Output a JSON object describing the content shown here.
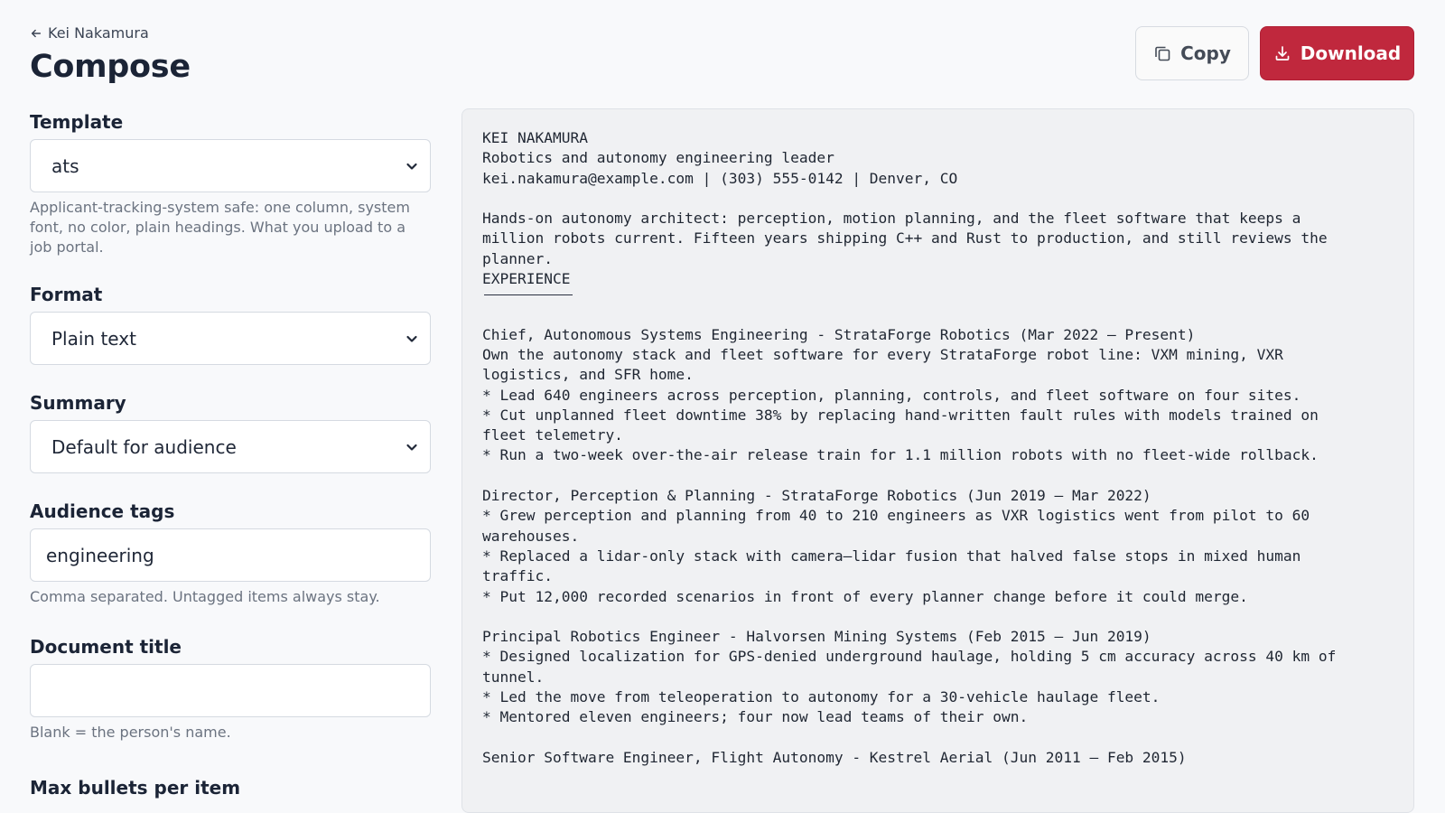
{
  "header": {
    "back_label": "Kei Nakamura",
    "title": "Compose",
    "copy_label": "Copy",
    "download_label": "Download"
  },
  "form": {
    "template": {
      "label": "Template",
      "value": "ats",
      "help": "Applicant-tracking-system safe: one column, system font, no color, plain headings. What you upload to a job portal."
    },
    "format": {
      "label": "Format",
      "value": "Plain text"
    },
    "summary": {
      "label": "Summary",
      "value": "Default for audience"
    },
    "audience_tags": {
      "label": "Audience tags",
      "value": "engineering",
      "help": "Comma separated. Untagged items always stay."
    },
    "document_title": {
      "label": "Document title",
      "value": "",
      "help": "Blank = the person's name."
    },
    "max_bullets": {
      "label": "Max bullets per item"
    }
  },
  "preview": {
    "header_block": "KEI NAKAMURA\nRobotics and autonomy engineering leader\nkei.nakamura@example.com | (303) 555-0142 | Denver, CO\n\nHands-on autonomy architect: perception, motion planning, and the fleet software that keeps a\nmillion robots current. Fifteen years shipping C++ and Rust to production, and still reviews the\nplanner.\n",
    "section_heading": "EXPERIENCE",
    "body_block": "\nChief, Autonomous Systems Engineering - StrataForge Robotics (Mar 2022 – Present)\nOwn the autonomy stack and fleet software for every StrataForge robot line: VXM mining, VXR\nlogistics, and SFR home.\n* Lead 640 engineers across perception, planning, controls, and fleet software on four sites.\n* Cut unplanned fleet downtime 38% by replacing hand-written fault rules with models trained on\nfleet telemetry.\n* Run a two-week over-the-air release train for 1.1 million robots with no fleet-wide rollback.\n\nDirector, Perception & Planning - StrataForge Robotics (Jun 2019 – Mar 2022)\n* Grew perception and planning from 40 to 210 engineers as VXR logistics went from pilot to 60\nwarehouses.\n* Replaced a lidar-only stack with camera–lidar fusion that halved false stops in mixed human\ntraffic.\n* Put 12,000 recorded scenarios in front of every planner change before it could merge.\n\nPrincipal Robotics Engineer - Halvorsen Mining Systems (Feb 2015 – Jun 2019)\n* Designed localization for GPS-denied underground haulage, holding 5 cm accuracy across 40 km of\ntunnel.\n* Led the move from teleoperation to autonomy for a 30-vehicle haulage fleet.\n* Mentored eleven engineers; four now lead teams of their own.\n\nSenior Software Engineer, Flight Autonomy - Kestrel Aerial (Jun 2011 – Feb 2015)"
  }
}
